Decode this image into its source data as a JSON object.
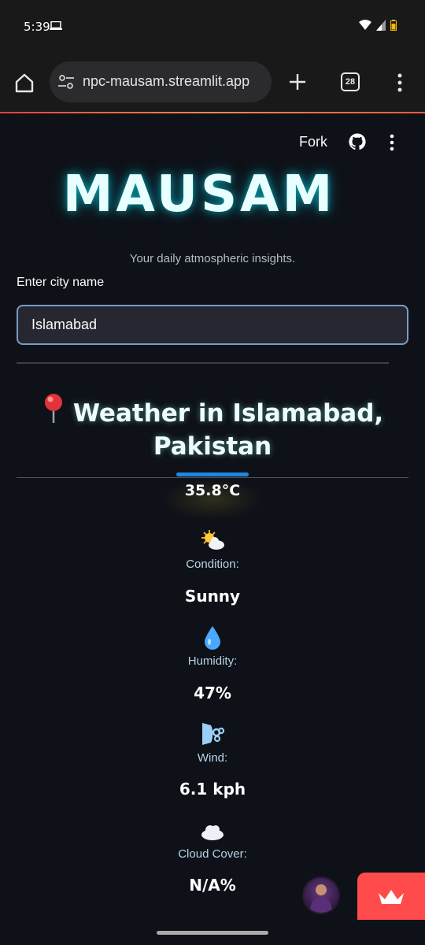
{
  "status_bar": {
    "time": "5:39"
  },
  "browser": {
    "url": "npc-mausam.streamlit.app",
    "tab_count": "28"
  },
  "app_header": {
    "fork_label": "Fork"
  },
  "hero": {
    "title": "MAUSAM",
    "subtitle": "Your daily atmospheric insights."
  },
  "search": {
    "label": "Enter city name",
    "value": "Islamabad"
  },
  "weather": {
    "heading_line1": "Weather in Islamabad,",
    "heading_line2": "Pakistan",
    "temperature": "35.8°C",
    "condition_label": "Condition:",
    "condition_value": "Sunny",
    "humidity_label": "Humidity:",
    "humidity_value": "47%",
    "wind_label": "Wind:",
    "wind_value": "6.1 kph",
    "cloud_label": "Cloud Cover:",
    "cloud_value": "N/A%"
  },
  "colors": {
    "background": "#0e1117",
    "accent_blue": "#1e88e5",
    "streamlit_red": "#ff4b4b",
    "title_glow": "#e8ffff"
  },
  "icons": {
    "condition": "sun-behind-cloud-icon",
    "humidity": "droplet-icon",
    "wind": "wind-face-icon",
    "cloud": "cloud-icon",
    "location": "round-pushpin-icon"
  }
}
